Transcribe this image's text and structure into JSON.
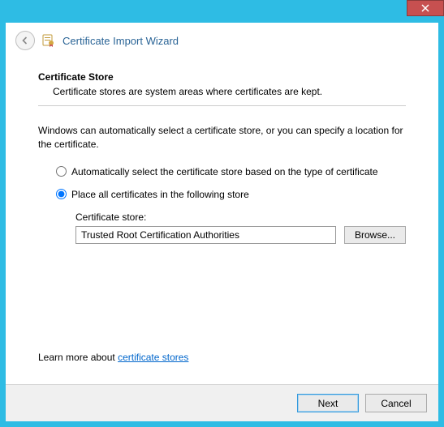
{
  "window": {
    "title": "Certificate Import Wizard"
  },
  "section": {
    "title": "Certificate Store",
    "subtitle": "Certificate stores are system areas where certificates are kept."
  },
  "instruction": "Windows can automatically select a certificate store, or you can specify a location for the certificate.",
  "radios": {
    "auto": "Automatically select the certificate store based on the type of certificate",
    "manual": "Place all certificates in the following store"
  },
  "store": {
    "label": "Certificate store:",
    "value": "Trusted Root Certification Authorities",
    "browse": "Browse..."
  },
  "learn": {
    "prefix": "Learn more about ",
    "link": "certificate stores"
  },
  "footer": {
    "next": "Next",
    "cancel": "Cancel"
  }
}
